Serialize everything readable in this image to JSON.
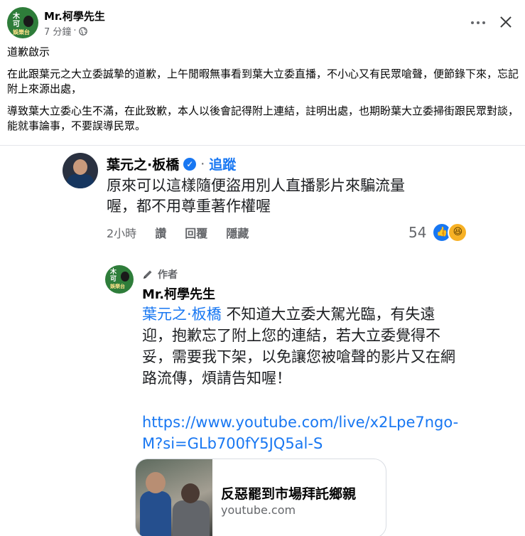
{
  "post": {
    "author": "Mr.柯學先生",
    "avatar_text": [
      "木",
      "可",
      "娛樂台"
    ],
    "time": "7 分鐘",
    "separator": "·",
    "privacy_icon": "globe-icon",
    "more_icon": "more-horizontal-icon",
    "close_icon": "close-icon",
    "paragraphs": [
      "道歉啟示",
      "在此跟葉元之大立委誠摯的道歉，上午閒暇無事看到葉大立委直播，不小心又有民眾嗆聲，便節錄下來，忘記附上來源出處，",
      "導致葉大立委心生不滿，在此致歉，本人以後會記得附上連結，註明出處，也期盼葉大立委掃街跟民眾對談，能就事論事，不要誤導民眾。"
    ]
  },
  "comment": {
    "name": "葉元之·板橋",
    "verified_icon": "verified-icon",
    "dot": "·",
    "follow": "追蹤",
    "text_line1": "原來可以這樣隨便盜用別人直播影片來騙流量",
    "text_line2": "喔，都不用尊重著作權喔",
    "time": "2小時",
    "like": "讚",
    "reply": "回覆",
    "hide": "隱藏",
    "reaction_count": "54",
    "reactions": [
      "like-icon",
      "haha-icon"
    ]
  },
  "reply": {
    "badge": "作者",
    "badge_icon": "pen-icon",
    "name": "Mr.柯學先生",
    "mention": "葉元之·板橋",
    "text": " 不知道大立委大駕光臨，有失遠迎，抱歉忘了附上您的連結，若大立委覺得不妥，需要我下架，以免讓您被嗆聲的影片又在網路流傳，煩請告知喔！",
    "link": "https://www.youtube.com/live/x2Lpe7ngo-M?si=GLb700fY5JQ5al-S",
    "card": {
      "title": "反惡罷到市場拜託鄉親",
      "domain": "youtube.com"
    }
  },
  "colors": {
    "link_blue": "#1877f2",
    "secondary_text": "#65676b",
    "avatar_green": "#2e7d3a"
  }
}
